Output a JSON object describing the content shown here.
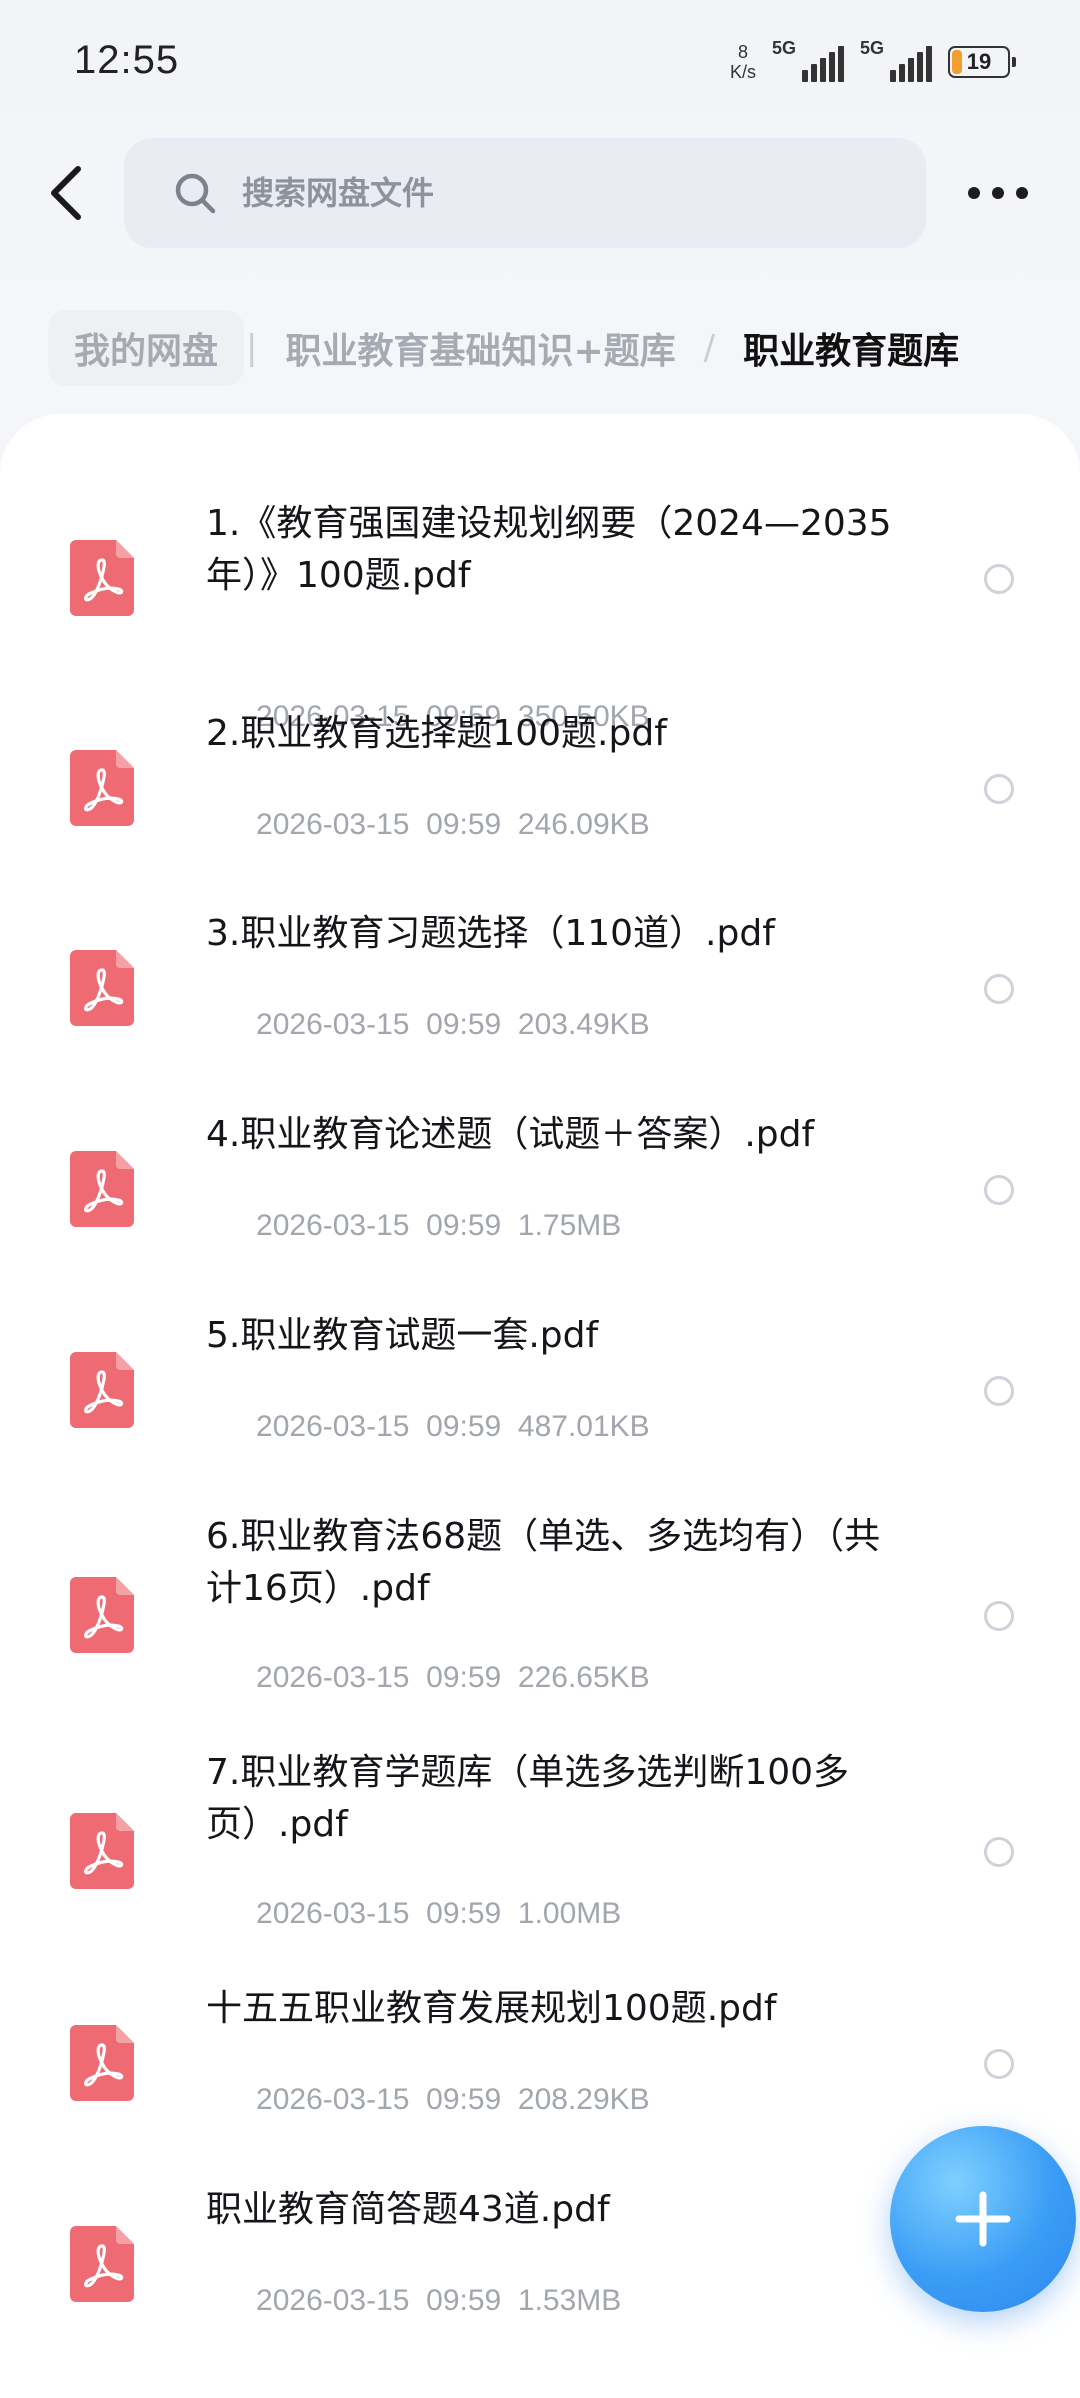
{
  "status_bar": {
    "time": "12:55",
    "net_speed_value": "8",
    "net_speed_unit": "K/s",
    "signal_1": "5G",
    "signal_2": "5G",
    "battery": "19",
    "battery_level_percent": 19,
    "battery_color": "#f0a030"
  },
  "header": {
    "back_icon": "chevron-left-icon",
    "search_placeholder": "搜索网盘文件",
    "search_icon": "search-icon",
    "more_icon": "more-horizontal-icon"
  },
  "breadcrumb": {
    "items": [
      "我的网盘",
      "职业教育基础知识+题库",
      "职业教育题库"
    ],
    "separators": [
      "|",
      "/"
    ]
  },
  "files": [
    {
      "name": "1.《教育强国建设规划纲要（2024—2035年）》100题.pdf",
      "date": "2026-03-15",
      "time": "09:59",
      "size": "350.50KB"
    },
    {
      "name": "2.职业教育选择题100题.pdf",
      "date": "2026-03-15",
      "time": "09:59",
      "size": "246.09KB"
    },
    {
      "name": "3.职业教育习题选择（110道）.pdf",
      "date": "2026-03-15",
      "time": "09:59",
      "size": "203.49KB"
    },
    {
      "name": "4.职业教育论述题（试题＋答案）.pdf",
      "date": "2026-03-15",
      "time": "09:59",
      "size": "1.75MB"
    },
    {
      "name": "5.职业教育试题一套.pdf",
      "date": "2026-03-15",
      "time": "09:59",
      "size": "487.01KB"
    },
    {
      "name": "6.职业教育法68题（单选、多选均有）（共计16页）.pdf",
      "date": "2026-03-15",
      "time": "09:59",
      "size": "226.65KB"
    },
    {
      "name": "7.职业教育学题库（单选多选判断100多页）.pdf",
      "date": "2026-03-15",
      "time": "09:59",
      "size": "1.00MB"
    },
    {
      "name": "十五五职业教育发展规划100题.pdf",
      "date": "2026-03-15",
      "time": "09:59",
      "size": "208.29KB"
    },
    {
      "name": "职业教育简答题43道.pdf",
      "date": "2026-03-15",
      "time": "09:59",
      "size": "1.53MB"
    }
  ],
  "file_icon": "pdf-file-icon",
  "fab_icon": "plus-icon",
  "colors": {
    "pdf_icon": "#ee6b73",
    "fab": "#3a9df5",
    "meta_text": "#a2a6ad"
  }
}
